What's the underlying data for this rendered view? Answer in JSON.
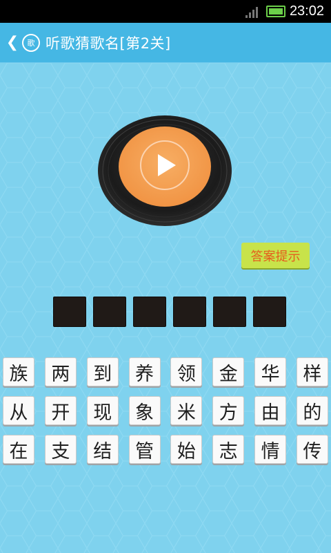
{
  "status": {
    "time": "23:02"
  },
  "header": {
    "badge_text": "歌",
    "title": "听歌猜歌名[第2关]"
  },
  "hint_button": {
    "label": "答案提示"
  },
  "answer_slots": 6,
  "keyboard": {
    "rows": [
      [
        "族",
        "两",
        "到",
        "养",
        "领",
        "金",
        "华",
        "样"
      ],
      [
        "从",
        "开",
        "现",
        "象",
        "米",
        "方",
        "由",
        "的"
      ],
      [
        "在",
        "支",
        "结",
        "管",
        "始",
        "志",
        "情",
        "传"
      ]
    ]
  },
  "colors": {
    "titlebar": "#45b7e4",
    "background": "#7fd2ee",
    "record_center": "#f5a051",
    "hint_bg": "#c8e34a",
    "hint_text": "#e55d1d"
  }
}
